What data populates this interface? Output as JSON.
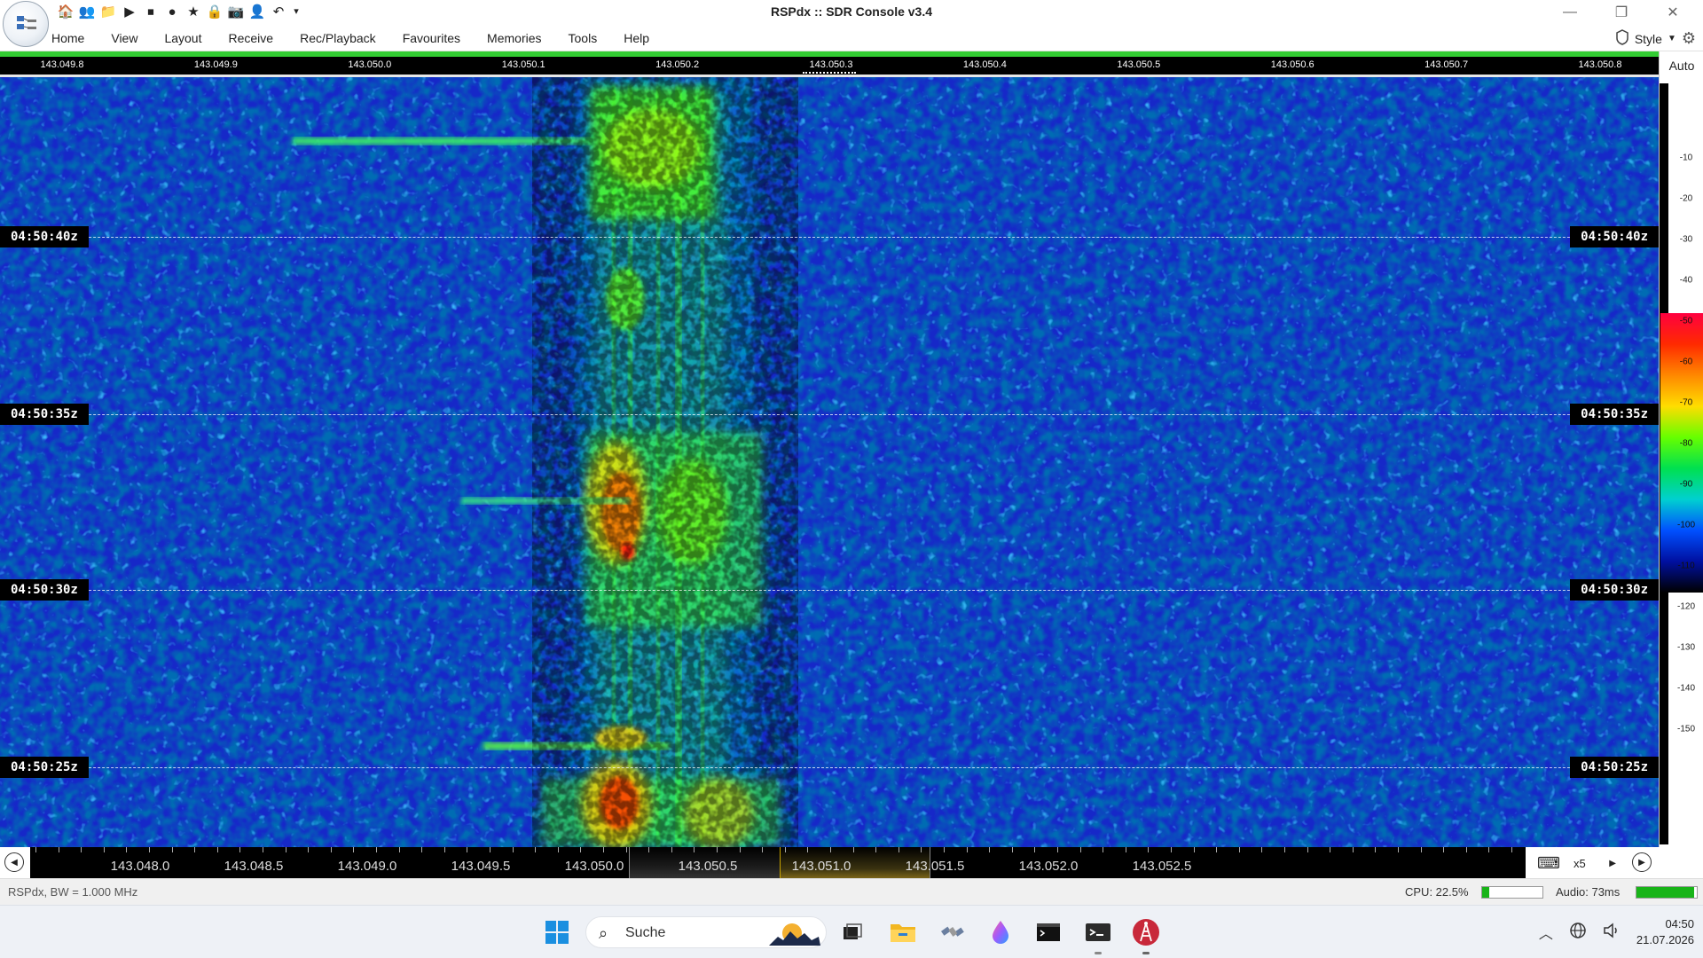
{
  "window": {
    "title": "RSPdx :: SDR Console v3.4",
    "minimize": "—",
    "restore": "❐",
    "close": "✕"
  },
  "quick_access": [
    {
      "icon": "home-icon",
      "glyph": "🏠"
    },
    {
      "icon": "users-icon",
      "glyph": "👥"
    },
    {
      "icon": "folder-icon",
      "glyph": "📁"
    },
    {
      "icon": "play-icon",
      "glyph": "▶"
    },
    {
      "icon": "stop-icon",
      "glyph": "⏹"
    },
    {
      "icon": "record-icon",
      "glyph": "●"
    },
    {
      "icon": "star-icon",
      "glyph": "★"
    },
    {
      "icon": "lock-icon",
      "glyph": "🔒"
    },
    {
      "icon": "camera-icon",
      "glyph": "📷"
    },
    {
      "icon": "person-icon",
      "glyph": "👤"
    },
    {
      "icon": "undo-icon",
      "glyph": "↶"
    },
    {
      "icon": "qat-dropdown-icon",
      "glyph": "▾"
    }
  ],
  "menu": {
    "items": [
      "Home",
      "View",
      "Layout",
      "Receive",
      "Rec/Playback",
      "Favourites",
      "Memories",
      "Tools",
      "Help"
    ],
    "style_label": "Style"
  },
  "top_ruler": {
    "ticks": [
      "143.049.8",
      "143.049.9",
      "143.050.0",
      "143.050.1",
      "143.050.2",
      "143.050.3",
      "143.050.4",
      "143.050.5",
      "143.050.6",
      "143.050.7",
      "143.050.8"
    ]
  },
  "waterfall": {
    "times": [
      "04:50:40z",
      "04:50:35z",
      "04:50:30z",
      "04:50:25z"
    ]
  },
  "scale": {
    "mode": "Auto",
    "ticks": [
      "-10",
      "-20",
      "-30",
      "-40",
      "-50",
      "-60",
      "-70",
      "-80",
      "-90",
      "-100",
      "-110",
      "-120",
      "-130",
      "-140",
      "-150"
    ],
    "gradient_colors": [
      "#ff0040",
      "#ff2a00",
      "#ff8800",
      "#ffdd00",
      "#66ff00",
      "#00e050",
      "#00d0d0",
      "#0050ff",
      "#0010a0",
      "#000000"
    ]
  },
  "bottom_ruler": {
    "ticks": [
      "143.048.0",
      "143.048.5",
      "143.049.0",
      "143.049.5",
      "143.050.0",
      "143.050.5",
      "143.051.0",
      "143.051.5",
      "143.052.0",
      "143.052.5"
    ],
    "zoom": "x5"
  },
  "status": {
    "device": "RSPdx, BW = 1.000 MHz",
    "cpu": "CPU: 22.5%",
    "cpu_fill": 0.12,
    "audio": "Audio: 73ms",
    "audio_fill": 0.95
  },
  "taskbar": {
    "search_placeholder": "Suche",
    "time": "04:50",
    "date": "21.07.2026"
  },
  "colors": {
    "waterfall_bg": "#1628c8",
    "signal_green": "#3cff3c",
    "signal_red": "#ff2020",
    "accent_green": "#33cc33"
  }
}
